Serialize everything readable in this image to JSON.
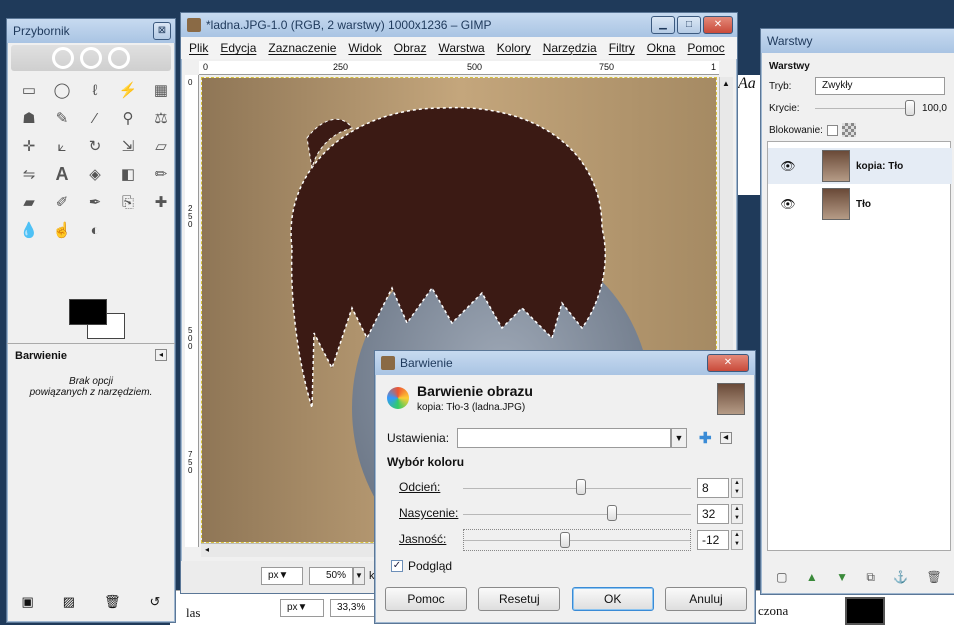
{
  "toolbox": {
    "title": "Przybornik",
    "panel_title": "Barwienie",
    "no_options_line1": "Brak opcji",
    "no_options_line2": "powiązanych z narzędziem."
  },
  "image_window": {
    "title": "*ladna.JPG-1.0 (RGB, 2 warstwy) 1000x1236 – GIMP",
    "menu": [
      "Plik",
      "Edycja",
      "Zaznaczenie",
      "Widok",
      "Obraz",
      "Warstwa",
      "Kolory",
      "Narzędzia",
      "Filtry",
      "Okna",
      "Pomoc"
    ],
    "ruler_ticks": [
      "0",
      "250",
      "500",
      "750",
      "1"
    ],
    "vruler_ticks": [
      "0",
      "2 5 0",
      "5 0 0",
      "7 5 0"
    ],
    "status_unit": "px▼",
    "status_zoom": "50%",
    "status_rest": "ko"
  },
  "back_window": {
    "status_unit": "px▼",
    "status_zoom": "33,3%",
    "left_text": "las",
    "right_text": "czona"
  },
  "layers": {
    "title": "Warstwy",
    "section": "Warstwy",
    "mode_label": "Tryb:",
    "mode_value": "Zwykły",
    "opacity_label": "Krycie:",
    "opacity_value": "100,0",
    "opacity_fraction": 1.0,
    "lock_label": "Blokowanie:",
    "items": [
      {
        "name": "kopia: Tło"
      },
      {
        "name": "Tło"
      }
    ]
  },
  "dialog": {
    "title": "Barwienie",
    "heading": "Barwienie obrazu",
    "subheading": "kopia: Tło-3 (ladna.JPG)",
    "settings_label": "Ustawienia:",
    "settings_value": "",
    "group_title": "Wybór koloru",
    "sliders": [
      {
        "label": "Odcień:",
        "value": "8",
        "fraction": 0.52
      },
      {
        "label": "Nasycenie:",
        "value": "32",
        "fraction": 0.66
      },
      {
        "label": "Jasność:",
        "value": "-12",
        "fraction": 0.44
      }
    ],
    "preview_label": "Podgląd",
    "preview_checked": true,
    "buttons": {
      "help": "Pomoc",
      "reset": "Resetuj",
      "ok": "OK",
      "cancel": "Anuluj"
    }
  },
  "colors": {
    "desktop": "#1f3a5a",
    "title_grad_top": "#c7daf0",
    "close_red": "#c94a3a",
    "canvas_bg": "#b5956c",
    "hair": "#3b1a14",
    "selection_dash": "#ffffff",
    "ok_focus": "#3a8bd6"
  }
}
